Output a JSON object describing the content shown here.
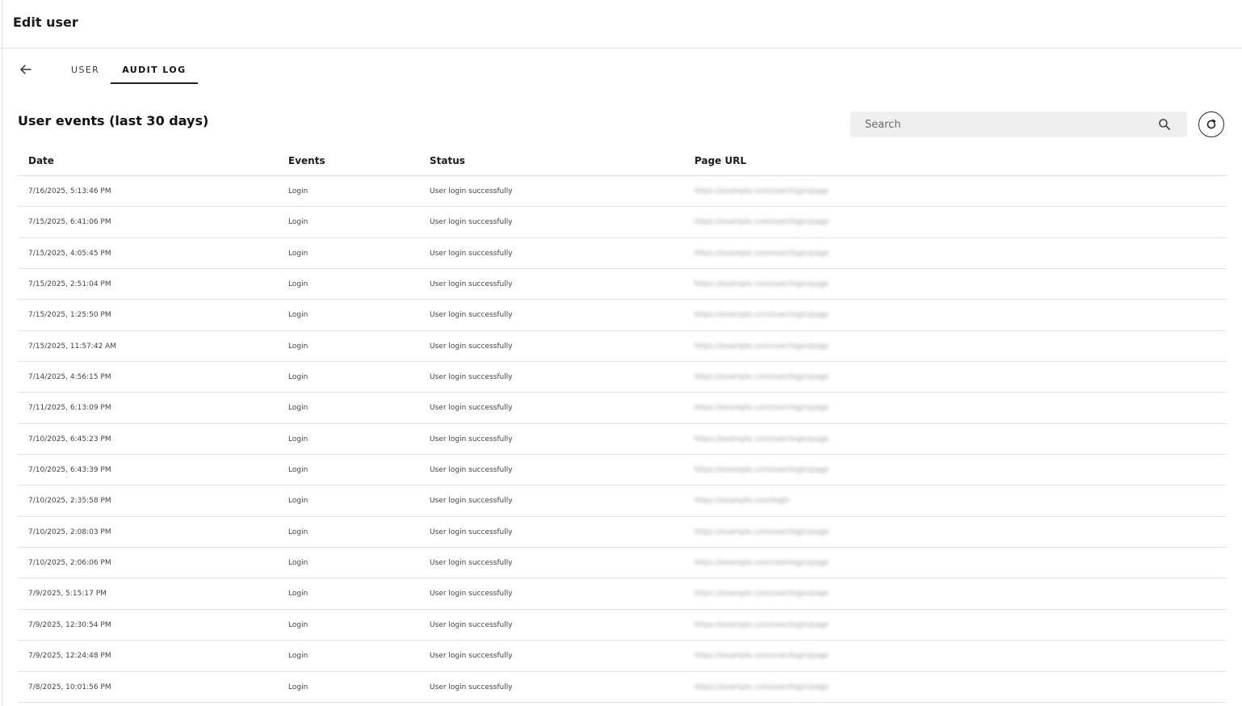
{
  "header": {
    "title": "Edit user"
  },
  "tabs": [
    {
      "label": "USER",
      "active": false
    },
    {
      "label": "AUDIT LOG",
      "active": true
    }
  ],
  "section": {
    "title": "User events (last 30 days)"
  },
  "search": {
    "placeholder": "Search",
    "value": ""
  },
  "table": {
    "columns": [
      "Date",
      "Events",
      "Status",
      "Page URL"
    ],
    "rows": [
      {
        "date": "7/16/2025, 5:13:46 PM",
        "event": "Login",
        "status": "User login successfully",
        "url": "https://example.com/user/login/page"
      },
      {
        "date": "7/15/2025, 6:41:06 PM",
        "event": "Login",
        "status": "User login successfully",
        "url": "https://example.com/user/login/page"
      },
      {
        "date": "7/15/2025, 4:05:45 PM",
        "event": "Login",
        "status": "User login successfully",
        "url": "https://example.com/user/login/page"
      },
      {
        "date": "7/15/2025, 2:51:04 PM",
        "event": "Login",
        "status": "User login successfully",
        "url": "https://example.com/user/login/page"
      },
      {
        "date": "7/15/2025, 1:25:50 PM",
        "event": "Login",
        "status": "User login successfully",
        "url": "https://example.com/user/login/page"
      },
      {
        "date": "7/15/2025, 11:57:42 AM",
        "event": "Login",
        "status": "User login successfully",
        "url": "https://example.com/user/login/page"
      },
      {
        "date": "7/14/2025, 4:56:15 PM",
        "event": "Login",
        "status": "User login successfully",
        "url": "https://example.com/user/login/page"
      },
      {
        "date": "7/11/2025, 6:13:09 PM",
        "event": "Login",
        "status": "User login successfully",
        "url": "https://example.com/user/login/page"
      },
      {
        "date": "7/10/2025, 6:45:23 PM",
        "event": "Login",
        "status": "User login successfully",
        "url": "https://example.com/user/login/page"
      },
      {
        "date": "7/10/2025, 6:43:39 PM",
        "event": "Login",
        "status": "User login successfully",
        "url": "https://example.com/user/login/page"
      },
      {
        "date": "7/10/2025, 2:35:58 PM",
        "event": "Login",
        "status": "User login successfully",
        "url": "https://example.com/login"
      },
      {
        "date": "7/10/2025, 2:08:03 PM",
        "event": "Login",
        "status": "User login successfully",
        "url": "https://example.com/user/login/page"
      },
      {
        "date": "7/10/2025, 2:06:06 PM",
        "event": "Login",
        "status": "User login successfully",
        "url": "https://example.com/user/login/page"
      },
      {
        "date": "7/9/2025, 5:15:17 PM",
        "event": "Login",
        "status": "User login successfully",
        "url": "https://example.com/user/login/page"
      },
      {
        "date": "7/9/2025, 12:30:54 PM",
        "event": "Login",
        "status": "User login successfully",
        "url": "https://example.com/user/login/page"
      },
      {
        "date": "7/9/2025, 12:24:48 PM",
        "event": "Login",
        "status": "User login successfully",
        "url": "https://example.com/user/login/page"
      },
      {
        "date": "7/8/2025, 10:01:56 PM",
        "event": "Login",
        "status": "User login successfully",
        "url": "https://example.com/user/login/page"
      }
    ]
  },
  "icons": {
    "back": "arrow-left-icon",
    "search": "search-icon",
    "refresh": "refresh-icon"
  }
}
